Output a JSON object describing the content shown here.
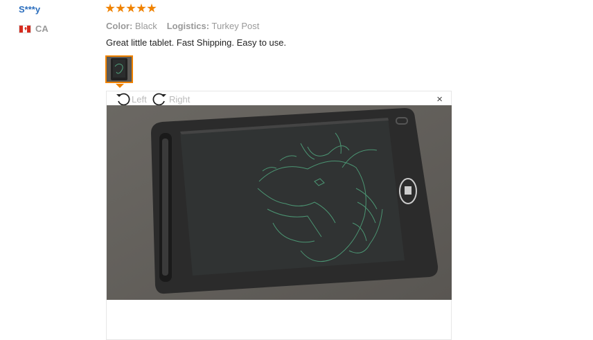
{
  "review": {
    "user_name": "S***y",
    "country_code": "CA",
    "rating": 5,
    "color_label": "Color:",
    "color_value": "Black",
    "logistics_label": "Logistics:",
    "logistics_value": "Turkey Post",
    "feedback": "Great little tablet. Fast Shipping. Easy to use."
  },
  "viewer": {
    "rotate_left_label": "Left",
    "rotate_right_label": "Right",
    "close_glyph": "×"
  },
  "colors": {
    "accent": "#f08200",
    "username": "#2a6dbd",
    "muted": "#999999"
  }
}
